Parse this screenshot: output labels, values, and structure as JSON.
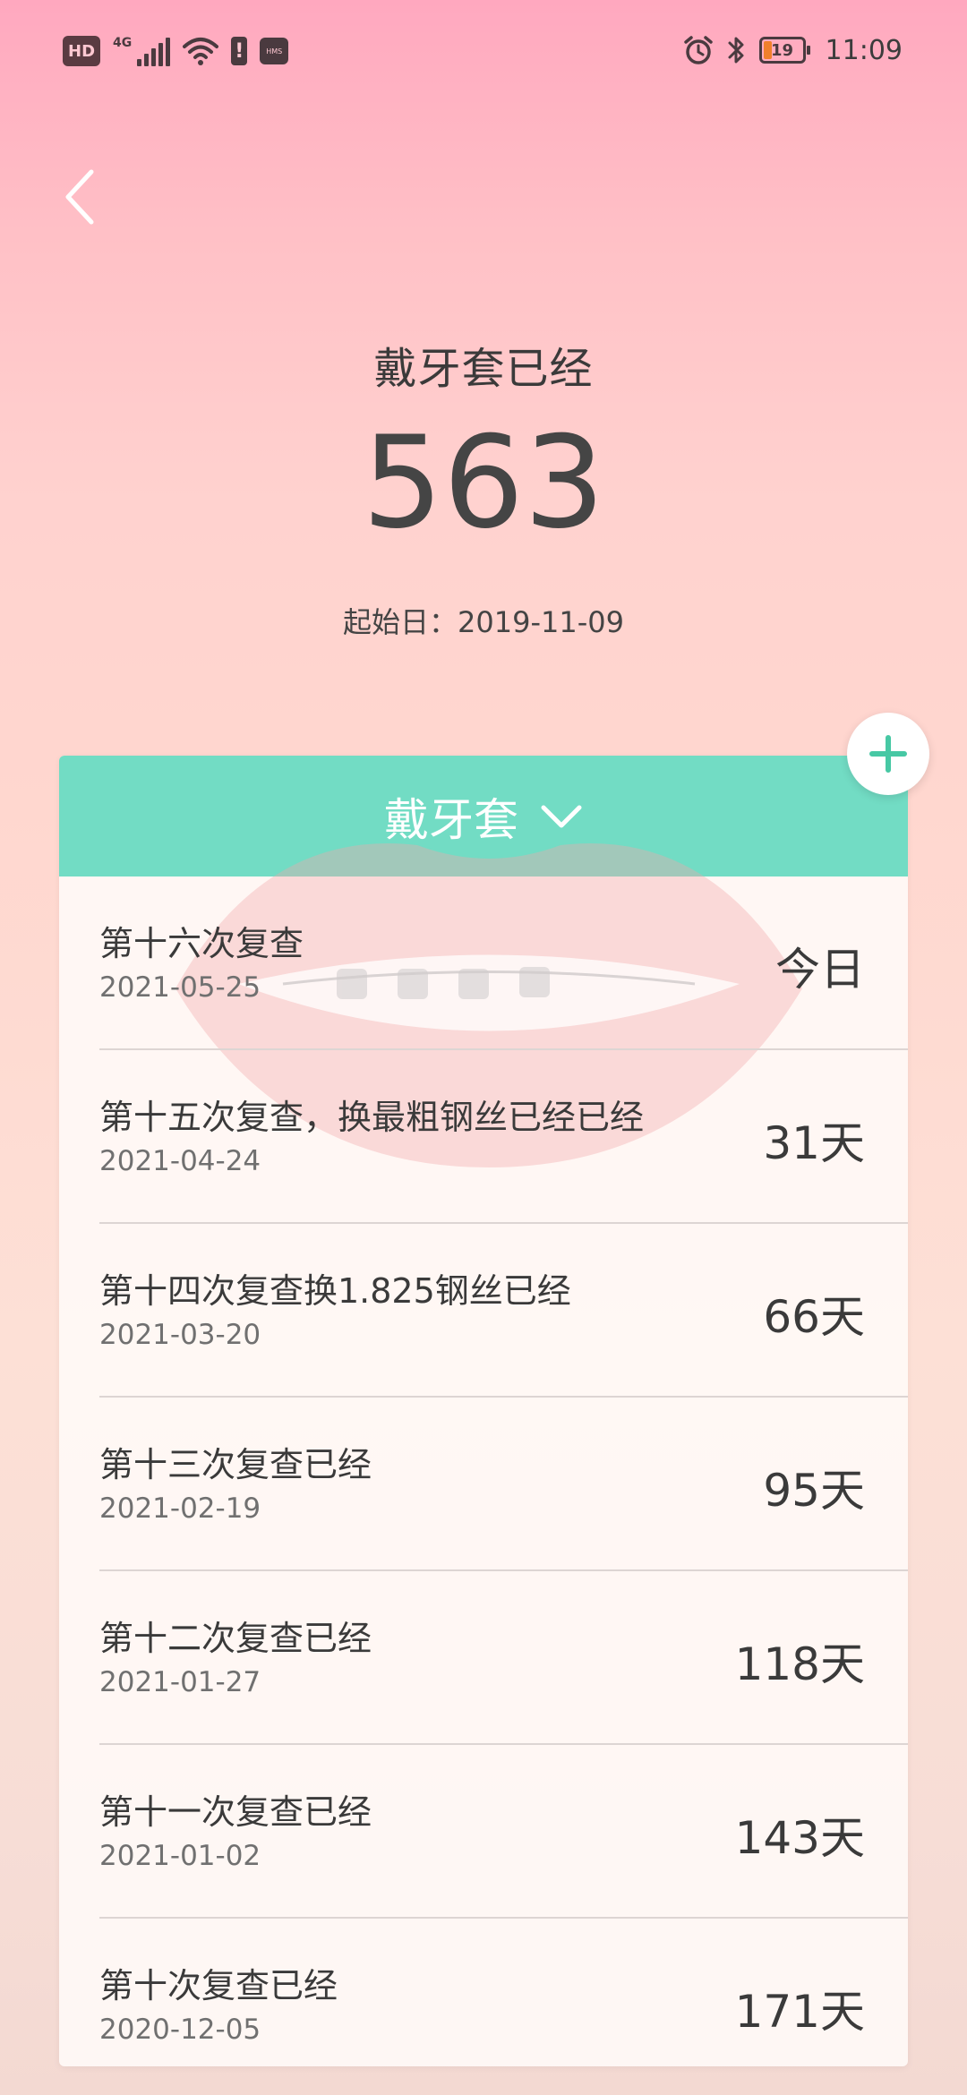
{
  "status_bar": {
    "hd": "HD",
    "network": "4G",
    "hms": "HMS",
    "battery": "19",
    "time": "11:09"
  },
  "header": {
    "title": "戴牙套已经",
    "count": "563",
    "start_label": "起始日：2019-11-09"
  },
  "category": {
    "label": "戴牙套"
  },
  "colors": {
    "accent": "#72dcc4",
    "add_icon": "#47c8a4"
  },
  "records": [
    {
      "title": "第十六次复查",
      "date": "2021-05-25",
      "days": "今日"
    },
    {
      "title": "第十五次复查，换最粗钢丝已经已经",
      "date": "2021-04-24",
      "days": "31天"
    },
    {
      "title": "第十四次复查换1.825钢丝已经",
      "date": "2021-03-20",
      "days": "66天"
    },
    {
      "title": "第十三次复查已经",
      "date": "2021-02-19",
      "days": "95天"
    },
    {
      "title": "第十二次复查已经",
      "date": "2021-01-27",
      "days": "118天"
    },
    {
      "title": "第十一次复查已经",
      "date": "2021-01-02",
      "days": "143天"
    },
    {
      "title": "第十次复查已经",
      "date": "2020-12-05",
      "days": "171天"
    }
  ]
}
